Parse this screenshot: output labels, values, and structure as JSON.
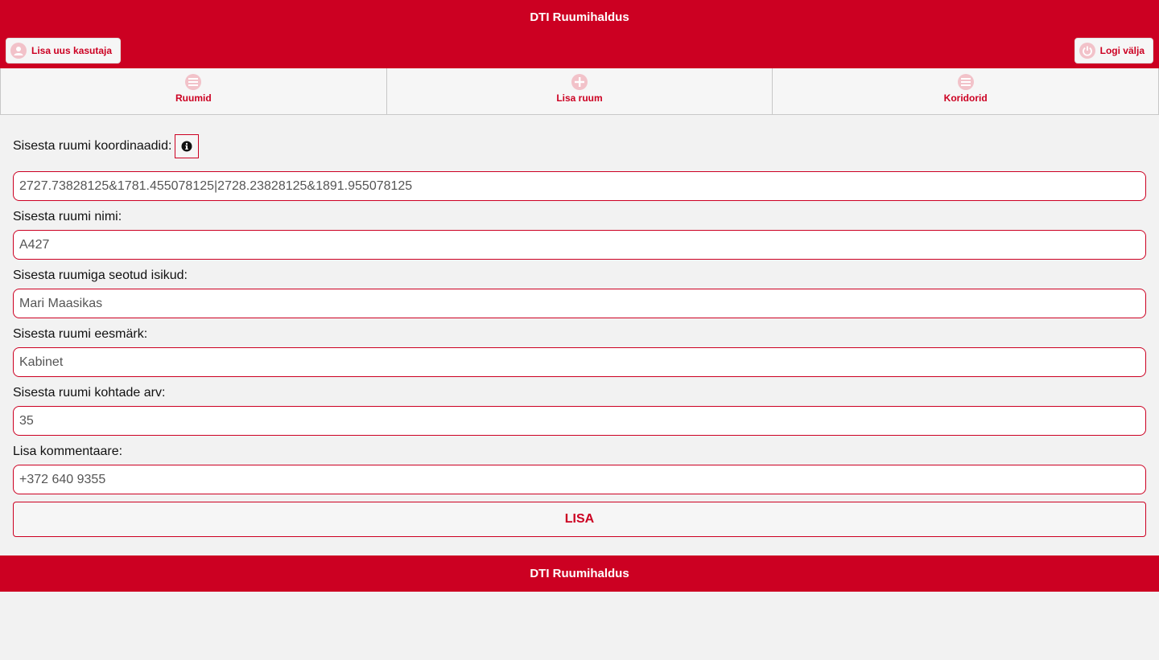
{
  "header": {
    "title": "DTI Ruumihaldus",
    "add_user_label": "Lisa uus kasutaja",
    "add_user_icon": "user-icon",
    "logout_label": "Logi välja",
    "logout_icon": "power-icon"
  },
  "nav": {
    "items": [
      {
        "label": "Ruumid",
        "icon": "list-icon"
      },
      {
        "label": "Lisa ruum",
        "icon": "plus-icon"
      },
      {
        "label": "Koridorid",
        "icon": "list-icon"
      }
    ]
  },
  "form": {
    "coordinates_label": "Sisesta ruumi koordinaadid:",
    "coordinates_value": "2727.73828125&1781.455078125|2728.23828125&1891.955078125",
    "name_label": "Sisesta ruumi nimi:",
    "name_value": "A427",
    "people_label": "Sisesta ruumiga seotud isikud:",
    "people_value": "Mari Maasikas",
    "purpose_label": "Sisesta ruumi eesmärk:",
    "purpose_value": "Kabinet",
    "seats_label": "Sisesta ruumi kohtade arv:",
    "seats_value": "35",
    "comments_label": "Lisa kommentaare:",
    "comments_value": "+372 640 9355",
    "submit_label": "LISA"
  },
  "footer": {
    "title": "DTI Ruumihaldus"
  },
  "colors": {
    "brand": "#cc0022",
    "background": "#f2f2f2",
    "icon_tint": "#f2c2c9"
  }
}
